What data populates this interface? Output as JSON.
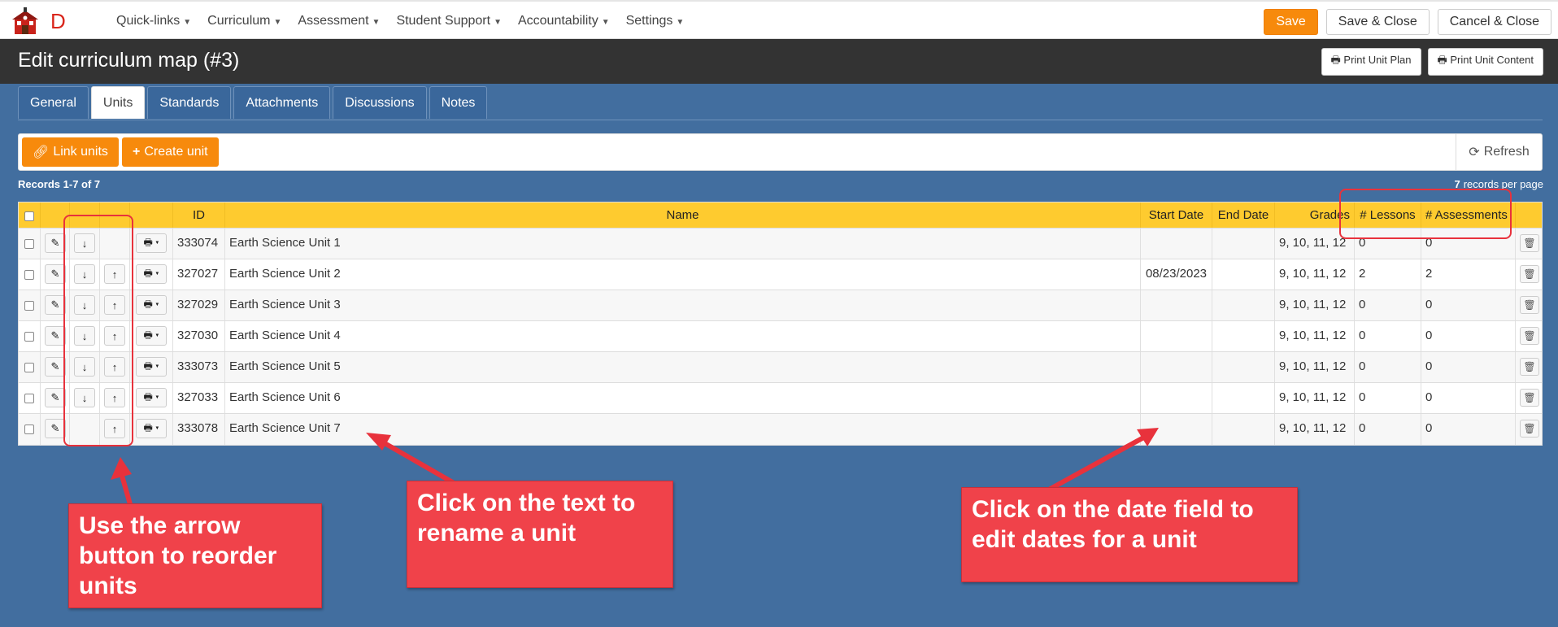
{
  "nav": {
    "logo_letter": "D",
    "menu": [
      "Quick-links",
      "Curriculum",
      "Assessment",
      "Student Support",
      "Accountability",
      "Settings"
    ],
    "save": "Save",
    "save_close": "Save & Close",
    "cancel_close": "Cancel & Close"
  },
  "header": {
    "title": "Edit curriculum map (#3)",
    "print_unit_plan": "Print Unit Plan",
    "print_unit_content": "Print Unit Content"
  },
  "tabs": [
    "General",
    "Units",
    "Standards",
    "Attachments",
    "Discussions",
    "Notes"
  ],
  "active_tab": "Units",
  "toolbar": {
    "link_units": "Link units",
    "create_unit": "Create unit",
    "refresh": "Refresh"
  },
  "records": {
    "summary": "Records 1-7 of 7",
    "per_page_count": "7",
    "per_page_label": "records per page"
  },
  "table": {
    "columns": {
      "id": "ID",
      "name": "Name",
      "start_date": "Start Date",
      "end_date": "End Date",
      "grades": "Grades",
      "lessons": "# Lessons",
      "assessments": "# Assessments"
    },
    "rows": [
      {
        "id": "333074",
        "name": "Earth Science Unit 1",
        "start": "",
        "end": "",
        "grades": "9, 10, 11, 12",
        "lessons": "0",
        "assessments": "0",
        "down": true,
        "up": false
      },
      {
        "id": "327027",
        "name": "Earth Science Unit 2",
        "start": "08/23/2023",
        "end": "",
        "grades": "9, 10, 11, 12",
        "lessons": "2",
        "assessments": "2",
        "down": true,
        "up": true
      },
      {
        "id": "327029",
        "name": "Earth Science Unit 3",
        "start": "",
        "end": "",
        "grades": "9, 10, 11, 12",
        "lessons": "0",
        "assessments": "0",
        "down": true,
        "up": true
      },
      {
        "id": "327030",
        "name": "Earth Science Unit 4",
        "start": "",
        "end": "",
        "grades": "9, 10, 11, 12",
        "lessons": "0",
        "assessments": "0",
        "down": true,
        "up": true
      },
      {
        "id": "333073",
        "name": "Earth Science Unit 5",
        "start": "",
        "end": "",
        "grades": "9, 10, 11, 12",
        "lessons": "0",
        "assessments": "0",
        "down": true,
        "up": true
      },
      {
        "id": "327033",
        "name": "Earth Science Unit 6",
        "start": "",
        "end": "",
        "grades": "9, 10, 11, 12",
        "lessons": "0",
        "assessments": "0",
        "down": true,
        "up": true
      },
      {
        "id": "333078",
        "name": "Earth Science Unit 7",
        "start": "",
        "end": "",
        "grades": "9, 10, 11, 12",
        "lessons": "0",
        "assessments": "0",
        "down": false,
        "up": true
      }
    ]
  },
  "annotations": {
    "reorder": "Use the arrow button to reorder units",
    "rename": "Click on the text to rename a unit",
    "dates": "Click on the date field to edit dates for a unit",
    "color": "#f0424a"
  },
  "icons": {
    "logo": "schoolhouse-icon",
    "link": "link-icon",
    "plus": "plus-icon",
    "refresh": "refresh-icon",
    "print": "printer-icon",
    "edit": "pencil-icon",
    "down": "arrow-down-icon",
    "up": "arrow-up-icon",
    "trash": "trash-icon"
  }
}
